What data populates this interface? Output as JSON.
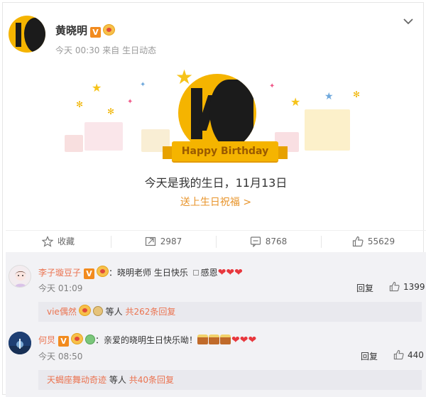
{
  "post": {
    "author": "黄晓明",
    "verified_badge": "V",
    "time": "今天 00:30",
    "source_prefix": "来自",
    "source": "生日动态"
  },
  "card": {
    "ribbon_text": "Happy Birthday",
    "message": "今天是我的生日，11月13日",
    "wish_link": "送上生日祝福 >"
  },
  "toolbar": {
    "favorite_label": "收藏",
    "repost_count": "2987",
    "comment_count": "8768",
    "like_count": "55629"
  },
  "comments": [
    {
      "name": "李子璇豆子",
      "text": "：晓明老师 生日快乐",
      "text_tail": "感恩",
      "time": "今天 01:09",
      "reply_label": "回复",
      "likes": "1399",
      "subreply_user": "vie偶然",
      "subreply_mid": "等人",
      "subreply_count": "共262条回复"
    },
    {
      "name": "何炅",
      "text": "：亲爱的晓明生日快乐呦！",
      "time": "今天 08:50",
      "reply_label": "回复",
      "likes": "440",
      "subreply_user": "天蝎座舞动奇迹",
      "subreply_mid": "等人",
      "subreply_count": "共40条回复"
    }
  ],
  "colors": {
    "accent_orange": "#eb7350",
    "gold": "#f5b400",
    "heart_red": "#e8373d"
  },
  "icons": [
    "chevron-down-icon",
    "star-icon",
    "repost-icon",
    "comment-icon",
    "like-icon",
    "heart-icon",
    "cake-icon"
  ]
}
